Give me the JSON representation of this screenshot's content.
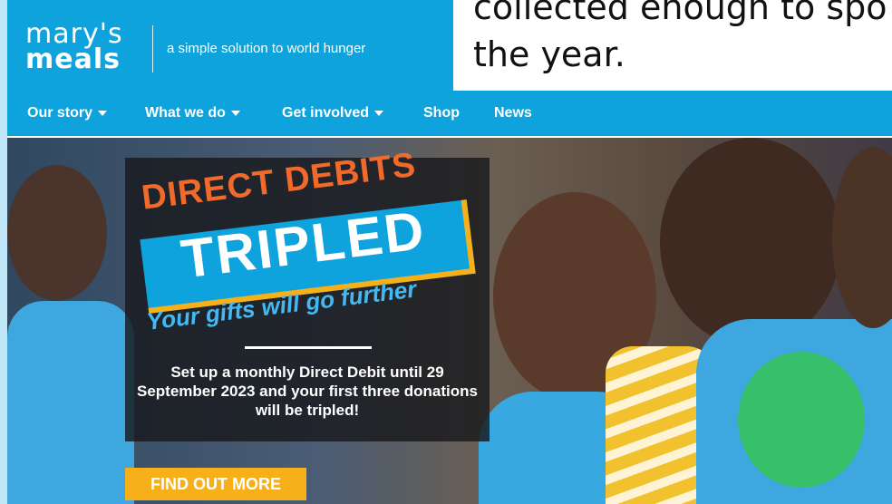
{
  "header": {
    "logo_line1": "mary's",
    "logo_line2": "meals",
    "tagline": "a simple solution to world hunger"
  },
  "slide": {
    "line1": "collected enough to spo",
    "line2": "the year."
  },
  "nav": {
    "items": [
      {
        "label": "Our story",
        "has_dropdown": true
      },
      {
        "label": "What we do",
        "has_dropdown": true
      },
      {
        "label": "Get involved",
        "has_dropdown": true
      },
      {
        "label": "Shop",
        "has_dropdown": false
      },
      {
        "label": "News",
        "has_dropdown": false
      }
    ]
  },
  "promo": {
    "heading": "DIRECT DEBITS",
    "highlight": "TRIPLED",
    "subheading": "Your gifts will go further",
    "body_part1": "Set up a monthly Direct Debit until",
    "body_date": "29 September 2023",
    "body_part2": "and your first three donations will be",
    "body_emphasis": "tripled",
    "body_end": "!",
    "cta": "FIND OUT MORE"
  },
  "colors": {
    "brand_blue": "#0ea3dc",
    "orange": "#f26a2a",
    "cta_yellow": "#f7b01a"
  }
}
